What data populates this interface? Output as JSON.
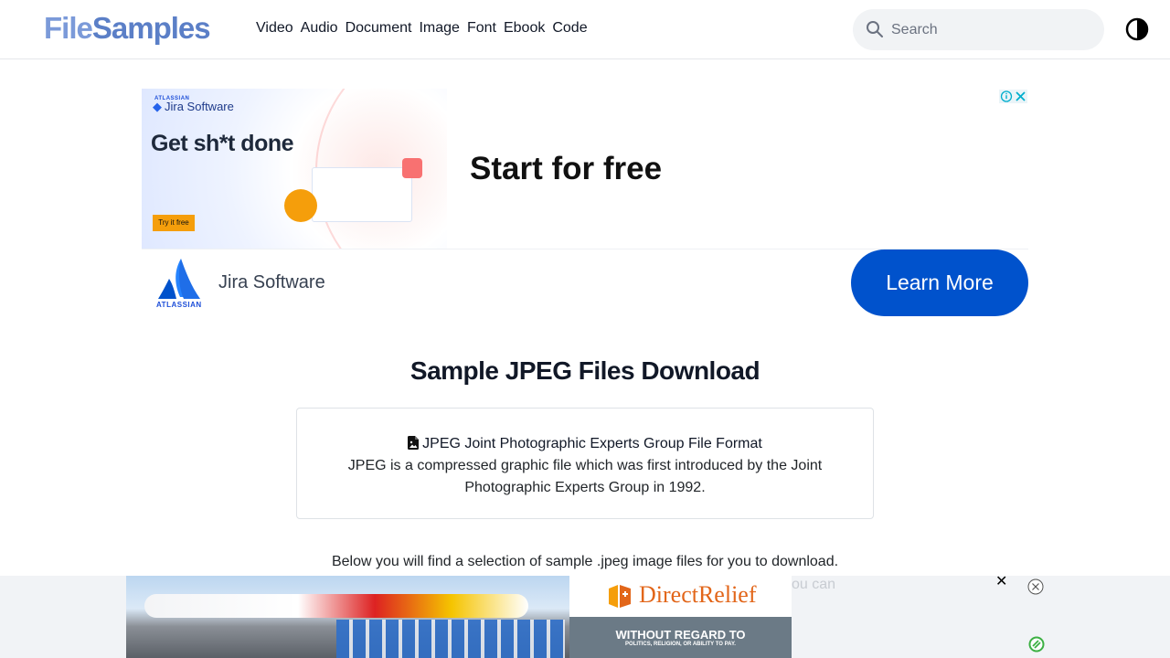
{
  "header": {
    "logo_part1": "File",
    "logo_part2": "Samples",
    "nav": [
      "Video",
      "Audio",
      "Document",
      "Image",
      "Font",
      "Ebook",
      "Code"
    ],
    "search_placeholder": "Search"
  },
  "top_ad": {
    "small_brand": "ATLASSIAN",
    "brand": "Jira Software",
    "headline_img": "Get sh*t done",
    "try_label": "Try it free",
    "headline": "Start for free",
    "advertiser_logo_text": "ATLASSIAN",
    "advertiser_name": "Jira Software",
    "cta": "Learn More"
  },
  "main": {
    "title": "Sample JPEG Files Download",
    "card_title": "JPEG Joint Photographic Experts Group File Format",
    "card_description": "JPEG is a compressed graphic file which was first introduced by the Joint Photographic Experts Group in 1992.",
    "below_text": "Below you will find a selection of sample .jpeg image files for you to download.",
    "partial_text": "ou can"
  },
  "sticky_ad": {
    "brand": "DirectRelief",
    "slogan": "WITHOUT REGARD TO",
    "slogan_sub": "POLITICS, RELIGION, OR ABILITY TO PAY."
  },
  "colors": {
    "logo_blue": "#5b7fc7",
    "cta_blue": "#0052cc",
    "direct_relief_orange": "#e2661a"
  }
}
